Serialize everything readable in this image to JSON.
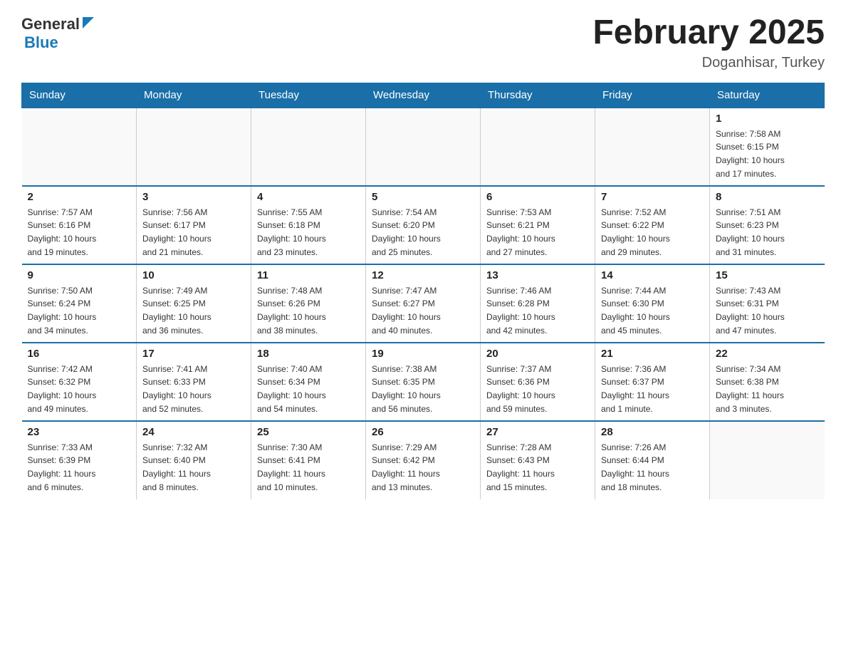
{
  "logo": {
    "general": "General",
    "blue": "Blue"
  },
  "title": "February 2025",
  "subtitle": "Doganhisar, Turkey",
  "days_of_week": [
    "Sunday",
    "Monday",
    "Tuesday",
    "Wednesday",
    "Thursday",
    "Friday",
    "Saturday"
  ],
  "weeks": [
    [
      {
        "day": "",
        "info": ""
      },
      {
        "day": "",
        "info": ""
      },
      {
        "day": "",
        "info": ""
      },
      {
        "day": "",
        "info": ""
      },
      {
        "day": "",
        "info": ""
      },
      {
        "day": "",
        "info": ""
      },
      {
        "day": "1",
        "info": "Sunrise: 7:58 AM\nSunset: 6:15 PM\nDaylight: 10 hours\nand 17 minutes."
      }
    ],
    [
      {
        "day": "2",
        "info": "Sunrise: 7:57 AM\nSunset: 6:16 PM\nDaylight: 10 hours\nand 19 minutes."
      },
      {
        "day": "3",
        "info": "Sunrise: 7:56 AM\nSunset: 6:17 PM\nDaylight: 10 hours\nand 21 minutes."
      },
      {
        "day": "4",
        "info": "Sunrise: 7:55 AM\nSunset: 6:18 PM\nDaylight: 10 hours\nand 23 minutes."
      },
      {
        "day": "5",
        "info": "Sunrise: 7:54 AM\nSunset: 6:20 PM\nDaylight: 10 hours\nand 25 minutes."
      },
      {
        "day": "6",
        "info": "Sunrise: 7:53 AM\nSunset: 6:21 PM\nDaylight: 10 hours\nand 27 minutes."
      },
      {
        "day": "7",
        "info": "Sunrise: 7:52 AM\nSunset: 6:22 PM\nDaylight: 10 hours\nand 29 minutes."
      },
      {
        "day": "8",
        "info": "Sunrise: 7:51 AM\nSunset: 6:23 PM\nDaylight: 10 hours\nand 31 minutes."
      }
    ],
    [
      {
        "day": "9",
        "info": "Sunrise: 7:50 AM\nSunset: 6:24 PM\nDaylight: 10 hours\nand 34 minutes."
      },
      {
        "day": "10",
        "info": "Sunrise: 7:49 AM\nSunset: 6:25 PM\nDaylight: 10 hours\nand 36 minutes."
      },
      {
        "day": "11",
        "info": "Sunrise: 7:48 AM\nSunset: 6:26 PM\nDaylight: 10 hours\nand 38 minutes."
      },
      {
        "day": "12",
        "info": "Sunrise: 7:47 AM\nSunset: 6:27 PM\nDaylight: 10 hours\nand 40 minutes."
      },
      {
        "day": "13",
        "info": "Sunrise: 7:46 AM\nSunset: 6:28 PM\nDaylight: 10 hours\nand 42 minutes."
      },
      {
        "day": "14",
        "info": "Sunrise: 7:44 AM\nSunset: 6:30 PM\nDaylight: 10 hours\nand 45 minutes."
      },
      {
        "day": "15",
        "info": "Sunrise: 7:43 AM\nSunset: 6:31 PM\nDaylight: 10 hours\nand 47 minutes."
      }
    ],
    [
      {
        "day": "16",
        "info": "Sunrise: 7:42 AM\nSunset: 6:32 PM\nDaylight: 10 hours\nand 49 minutes."
      },
      {
        "day": "17",
        "info": "Sunrise: 7:41 AM\nSunset: 6:33 PM\nDaylight: 10 hours\nand 52 minutes."
      },
      {
        "day": "18",
        "info": "Sunrise: 7:40 AM\nSunset: 6:34 PM\nDaylight: 10 hours\nand 54 minutes."
      },
      {
        "day": "19",
        "info": "Sunrise: 7:38 AM\nSunset: 6:35 PM\nDaylight: 10 hours\nand 56 minutes."
      },
      {
        "day": "20",
        "info": "Sunrise: 7:37 AM\nSunset: 6:36 PM\nDaylight: 10 hours\nand 59 minutes."
      },
      {
        "day": "21",
        "info": "Sunrise: 7:36 AM\nSunset: 6:37 PM\nDaylight: 11 hours\nand 1 minute."
      },
      {
        "day": "22",
        "info": "Sunrise: 7:34 AM\nSunset: 6:38 PM\nDaylight: 11 hours\nand 3 minutes."
      }
    ],
    [
      {
        "day": "23",
        "info": "Sunrise: 7:33 AM\nSunset: 6:39 PM\nDaylight: 11 hours\nand 6 minutes."
      },
      {
        "day": "24",
        "info": "Sunrise: 7:32 AM\nSunset: 6:40 PM\nDaylight: 11 hours\nand 8 minutes."
      },
      {
        "day": "25",
        "info": "Sunrise: 7:30 AM\nSunset: 6:41 PM\nDaylight: 11 hours\nand 10 minutes."
      },
      {
        "day": "26",
        "info": "Sunrise: 7:29 AM\nSunset: 6:42 PM\nDaylight: 11 hours\nand 13 minutes."
      },
      {
        "day": "27",
        "info": "Sunrise: 7:28 AM\nSunset: 6:43 PM\nDaylight: 11 hours\nand 15 minutes."
      },
      {
        "day": "28",
        "info": "Sunrise: 7:26 AM\nSunset: 6:44 PM\nDaylight: 11 hours\nand 18 minutes."
      },
      {
        "day": "",
        "info": ""
      }
    ]
  ]
}
